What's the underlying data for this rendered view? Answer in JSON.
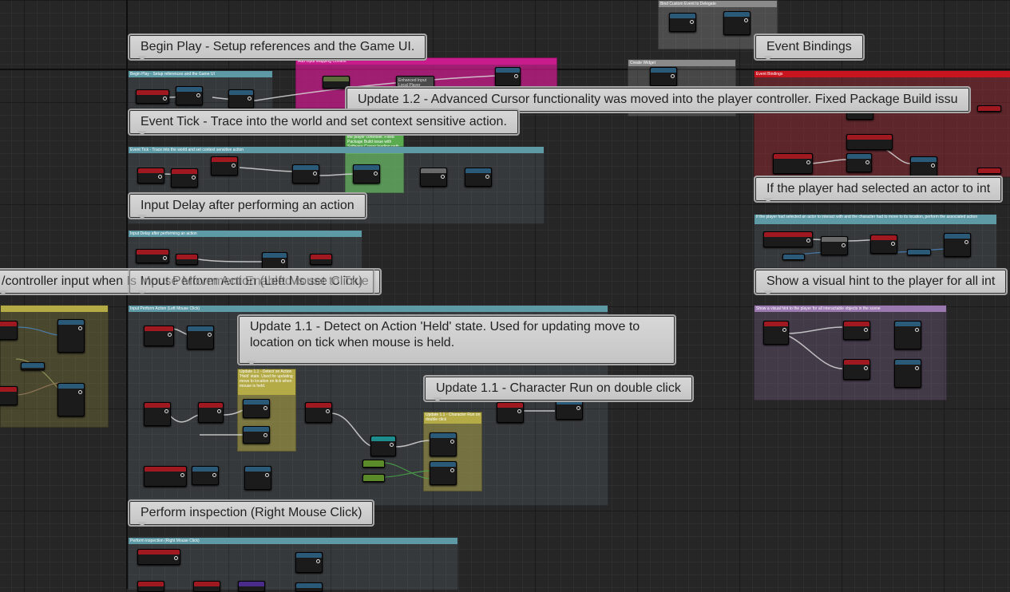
{
  "comments": [
    {
      "id": "begin-play",
      "bubble": "Begin Play - Setup references and the Game UI.",
      "header": "Begin Play - Setup references and the Game UI"
    },
    {
      "id": "event-bindings",
      "bubble": "Event Bindings",
      "header": "Event Bindings"
    },
    {
      "id": "update-1-2",
      "bubble": "Update 1.2 - Advanced Cursor functionality was moved into the player controller. Fixed Package Build issu",
      "header": "Update 1.2 - Advanced Cursor functionality was moved into the player controller. Fixed Package Build issue with Software Cursor loading path."
    },
    {
      "id": "event-tick",
      "bubble": "Event Tick - Trace into the world and set context sensitive action.",
      "header": "Event Tick - Trace into the world and set context sensitive action"
    },
    {
      "id": "player-selected",
      "bubble": "If the player had selected an actor to int",
      "header": "If the player had selected an actor to interact with and the character had to move to its location, perform the associated action"
    },
    {
      "id": "input-delay",
      "bubble": "Input Delay after performing an action",
      "header": "Input Delay after performing an action"
    },
    {
      "id": "controller-input",
      "bubble": "/controller input when Is Mouse Movement Enabled is set to True",
      "header": ""
    },
    {
      "id": "input-perform",
      "bubble": "Input Perform Action (Left Mouse Click)",
      "header": "Input Perform Action (Left Mouse Click)"
    },
    {
      "id": "visual-hint",
      "bubble": "Show a visual hint to the player for all int",
      "header": "Show a visual hint to the player for all interactable objects in the scene"
    },
    {
      "id": "update-1-1-held",
      "bubble": "Update 1.1 - Detect on Action 'Held' state. Used for updating move to location on tick when mouse is held.",
      "header": "Update 1.1 - Detect on Action 'Held' state. Used for updating move to location on tick when mouse is held."
    },
    {
      "id": "update-1-1-run",
      "bubble": "Update 1.1 - Character Run on double click",
      "header": "Update 1.1 - Character Run on double click"
    },
    {
      "id": "perform-inspection",
      "bubble": "Perform inspection (Right Mouse Click)",
      "header": "Perform inspection (Right Mouse Click)"
    }
  ],
  "small_labels": {
    "mapping_context": "Add Input Mapping Context",
    "create_widget": "Create Widget",
    "top_box": "Bind Custom Event to Delegate",
    "enhanced": "Enhanced Input Local Player Subsystem"
  },
  "colors": {
    "comment_teal": "#5e9aa6",
    "comment_red": "#c8141e",
    "comment_magenta": "#c81c8c",
    "comment_green": "#5aaa50",
    "comment_yellow": "#b4aa46",
    "comment_purple": "#9a78b0",
    "comment_olive": "#8c8c3c",
    "node_red": "#a01820",
    "node_blue": "#2a5a78",
    "node_teal": "#1e8c8c",
    "node_grey": "#6a6a6a",
    "node_green": "#5a8a2a",
    "node_purple": "#4a2a8a"
  }
}
